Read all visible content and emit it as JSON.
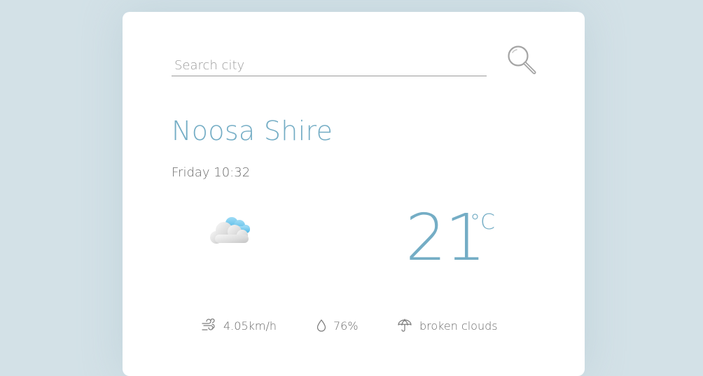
{
  "search": {
    "placeholder": "Search city",
    "value": "",
    "button_icon": "magnifier-icon"
  },
  "location": {
    "city": "Noosa Shire",
    "datetime": "Friday 10:32"
  },
  "current": {
    "condition_icon": "broken-clouds-icon",
    "temperature": "21",
    "unit": "°C"
  },
  "stats": {
    "wind": {
      "icon": "wind-icon",
      "value": "4.05km/h"
    },
    "humidity": {
      "icon": "droplet-icon",
      "value": "76%"
    },
    "description": {
      "icon": "umbrella-icon",
      "value": "broken clouds"
    }
  },
  "colors": {
    "background": "#d3e1e7",
    "card": "#ffffff",
    "accent": "#74adc5",
    "text_muted": "#6a6a6a"
  }
}
